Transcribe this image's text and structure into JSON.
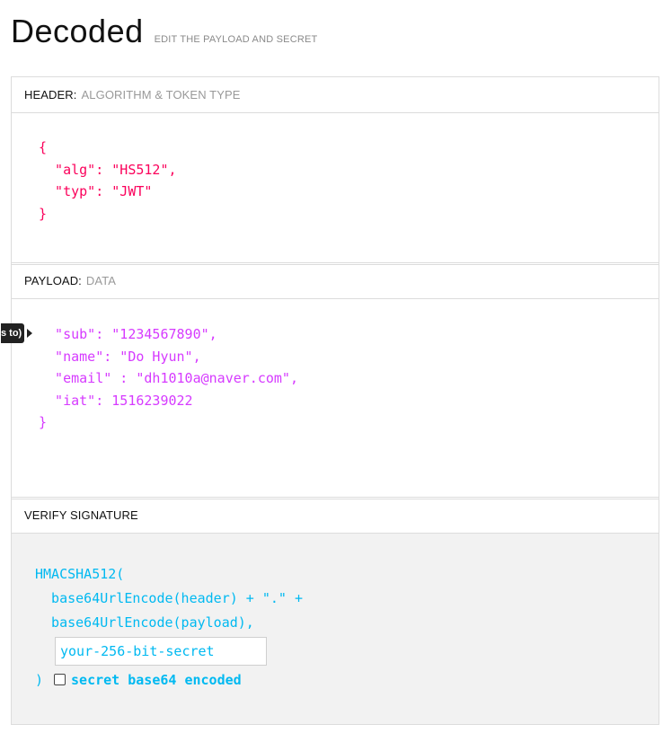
{
  "title": "Decoded",
  "subtitle": "EDIT THE PAYLOAD AND SECRET",
  "header_section": {
    "label": "HEADER:",
    "sublabel": "ALGORITHM & TOKEN TYPE",
    "code": "{\n  \"alg\": \"HS512\",\n  \"typ\": \"JWT\"\n}"
  },
  "payload_section": {
    "label": "PAYLOAD:",
    "sublabel": "DATA",
    "tooltip": "s to)",
    "code": "  \"sub\": \"1234567890\",\n  \"name\": \"Do Hyun\",\n  \"email\" : \"dh1010a@naver.com\",\n  \"iat\": 1516239022\n}"
  },
  "signature_section": {
    "label": "VERIFY SIGNATURE",
    "line1": "HMACSHA512(",
    "line2": "  base64UrlEncode(header) + \".\" +",
    "line3": "  base64UrlEncode(payload),",
    "secret_placeholder": "your-256-bit-secret",
    "close_paren": ")",
    "checkbox_label": "secret base64 encoded"
  },
  "colors": {
    "header_code": "#fb015b",
    "payload_code": "#d63aff",
    "signature_code": "#00b9f1"
  }
}
